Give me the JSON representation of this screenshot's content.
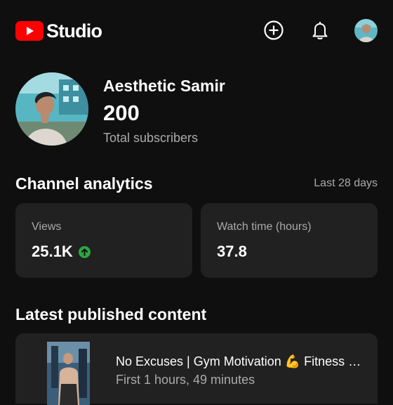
{
  "app": {
    "brand": "Studio",
    "brand_color": "#ff0000",
    "logo_icon": "youtube-play-logo"
  },
  "header": {
    "create_icon": "add-circle-icon",
    "notifications_icon": "bell-icon",
    "account_icon": "account-avatar"
  },
  "channel": {
    "name": "Aesthetic Samir",
    "subscriber_count": "200",
    "subscriber_label": "Total subscribers"
  },
  "analytics": {
    "title": "Channel analytics",
    "period": "Last 28 days",
    "views": {
      "label": "Views",
      "value": "25.1K",
      "trend": "up",
      "trend_color": "#2ba640"
    },
    "watch_time": {
      "label": "Watch time (hours)",
      "value": "37.8"
    }
  },
  "latest": {
    "title": "Latest published content",
    "video": {
      "title": "No Excuses | Gym Motivation 💪  Fitness Motivation",
      "meta": "First 1 hours, 49 minutes"
    }
  },
  "colors": {
    "background": "#0f0f0f",
    "card": "#212121",
    "secondary_text": "#aaaaaa"
  }
}
